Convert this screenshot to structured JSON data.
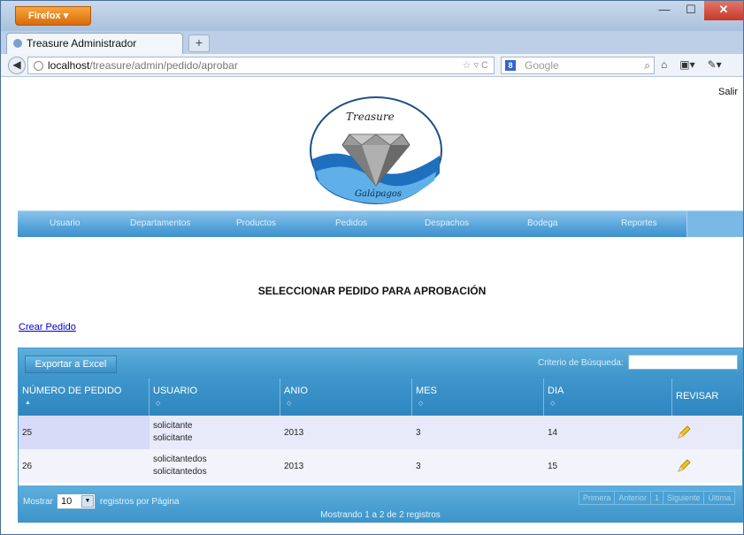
{
  "browser": {
    "app_button": "Firefox",
    "tab_title": "Treasure Administrador",
    "new_tab": "+",
    "url_host": "localhost",
    "url_path": "/treasure/admin/pedido/aprobar",
    "search_placeholder": "Google"
  },
  "header": {
    "logout": "Salir",
    "logo_text_top": "Treasure",
    "logo_text_bottom": "Galápagos"
  },
  "menu": {
    "items": [
      "Usuario",
      "Departamentos",
      "Productos",
      "Pedidos",
      "Despachos",
      "Bodega",
      "Reportes"
    ]
  },
  "main": {
    "title": "SELECCIONAR PEDIDO PARA APROBACIÓN",
    "create_link": "Crear Pedido"
  },
  "grid": {
    "export_label": "Exportar a Excel",
    "search_label": "Criterio de Búsqueda:",
    "search_value": "",
    "columns": [
      "NÚMERO DE PEDIDO",
      "USUARIO",
      "ANIO",
      "MES",
      "DIA",
      "REVISAR"
    ],
    "rows": [
      {
        "numero": "25",
        "usuario_1": "solicitante",
        "usuario_2": "solicitante",
        "anio": "2013",
        "mes": "3",
        "dia": "14"
      },
      {
        "numero": "26",
        "usuario_1": "solicitantedos",
        "usuario_2": "solicitantedos",
        "anio": "2013",
        "mes": "3",
        "dia": "15"
      }
    ],
    "footer": {
      "show_label": "Mostrar",
      "page_length": "10",
      "per_page_label": "registros por Página",
      "info": "Mostrando 1 a 2 de 2 registros",
      "pager": [
        "Primera",
        "Anterior",
        "1",
        "Siguiente",
        "Última"
      ]
    }
  },
  "colors": {
    "menu_blue": "#5aa6dc",
    "grid_blue": "#3c94c9",
    "row_odd": "#e9eaf9",
    "row_even": "#f2f3fb"
  }
}
